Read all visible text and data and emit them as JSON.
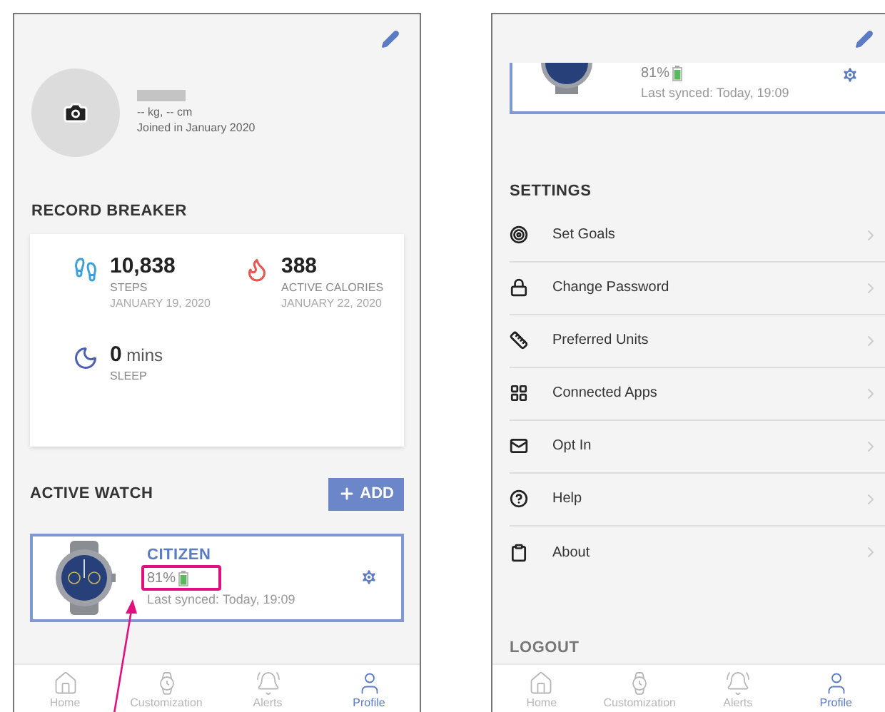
{
  "left_screen": {
    "profile": {
      "measurements": "-- kg, -- cm",
      "joined": "Joined in January 2020"
    },
    "record_breaker": {
      "title": "RECORD BREAKER",
      "records": [
        {
          "value": "10,838",
          "label": "STEPS",
          "date": "JANUARY 19, 2020"
        },
        {
          "value": "388",
          "label": "ACTIVE CALORIES",
          "date": "JANUARY 22, 2020"
        },
        {
          "value": "0",
          "unit": "mins",
          "label": "SLEEP"
        }
      ]
    },
    "active_watch": {
      "title": "ACTIVE WATCH",
      "add_button": "ADD",
      "watch": {
        "brand": "CITIZEN",
        "battery": "81%",
        "last_synced": "Last synced: Today, 19:09"
      }
    },
    "tab_bar": [
      {
        "label": "Home",
        "selected": false
      },
      {
        "label": "Customization",
        "selected": false
      },
      {
        "label": "Alerts",
        "selected": false
      },
      {
        "label": "Profile",
        "selected": true
      }
    ]
  },
  "right_screen": {
    "watch": {
      "battery": "81%",
      "last_synced": "Last synced: Today, 19:09"
    },
    "settings": {
      "title": "SETTINGS",
      "items": [
        "Set Goals",
        "Change Password",
        "Preferred Units",
        "Connected Apps",
        "Opt In",
        "Help",
        "About"
      ]
    },
    "logout": "LOGOUT",
    "tab_bar": [
      {
        "label": "Home",
        "selected": false
      },
      {
        "label": "Customization",
        "selected": false
      },
      {
        "label": "Alerts",
        "selected": false
      },
      {
        "label": "Profile",
        "selected": true
      }
    ]
  }
}
